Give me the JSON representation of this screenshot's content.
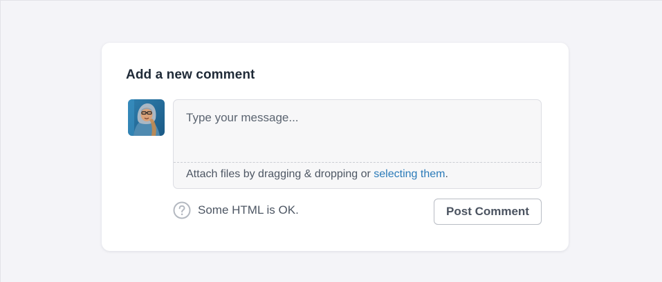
{
  "comment_form": {
    "heading": "Add a new comment",
    "message_placeholder": "Type your message...",
    "message_value": "",
    "attach_text": "Attach files by dragging & dropping or ",
    "attach_link": "selecting them",
    "attach_suffix": ".",
    "help_text": "Some HTML is OK.",
    "help_icon": "question-circle-icon",
    "submit_label": "Post Comment"
  },
  "colors": {
    "page_background": "#f4f4f8",
    "card_background": "#ffffff",
    "link": "#2a7ab8",
    "text": "#4d5663",
    "heading": "#1f2a37"
  }
}
